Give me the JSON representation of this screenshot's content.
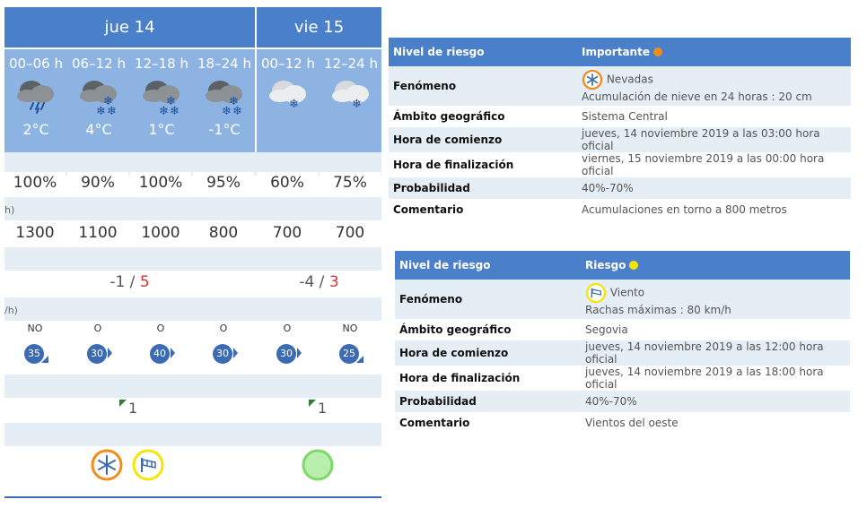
{
  "days": [
    {
      "label": "jue 14"
    },
    {
      "label": "vie 15"
    }
  ],
  "periods": [
    {
      "label": "00–06 h",
      "temp": "2°C",
      "icon": "cloud-rain-icon"
    },
    {
      "label": "06–12 h",
      "temp": "4°C",
      "icon": "cloud-snow-icon"
    },
    {
      "label": "12–18 h",
      "temp": "1°C",
      "icon": "cloud-snow-icon"
    },
    {
      "label": "18–24 h",
      "temp": "-1°C",
      "icon": "cloud-snow-icon"
    },
    {
      "label": "00–12 h",
      "temp": "",
      "icon": "cloud-snow-light-icon"
    },
    {
      "label": "12–24 h",
      "temp": "",
      "icon": "cloud-snow-light-icon"
    }
  ],
  "precip_prob_label": "",
  "precip_prob": [
    "100%",
    "90%",
    "100%",
    "95%",
    "60%",
    "75%"
  ],
  "snow_level_label": "h)",
  "snow_level": [
    "1300",
    "1100",
    "1000",
    "800",
    "700",
    "700"
  ],
  "temp_range": [
    {
      "min": "-1",
      "sep": " / ",
      "max": "5"
    },
    {
      "min": "-4",
      "sep": " / ",
      "max": "3"
    }
  ],
  "wind_label": "/h)",
  "wind": [
    {
      "dir": "NO",
      "speed": "35"
    },
    {
      "dir": "O",
      "speed": "30"
    },
    {
      "dir": "O",
      "speed": "40"
    },
    {
      "dir": "O",
      "speed": "30"
    },
    {
      "dir": "O",
      "speed": "30"
    },
    {
      "dir": "NO",
      "speed": "25"
    }
  ],
  "uv": [
    "1",
    "1"
  ],
  "warning_icons": {
    "snow": "snowflake-icon",
    "wind": "wind-icon",
    "none": "no-warning-icon"
  },
  "colors": {
    "header": "#4a7fc9",
    "period_bg": "#8db3e3",
    "band": "#e5eef5",
    "orange": "#f28c1a",
    "yellow": "#f5e50a",
    "green": "#7ed86a"
  },
  "alert1": {
    "rows": [
      {
        "k": "Nivel de riesgo",
        "v": "Importante"
      },
      {
        "k": "Fenómeno",
        "v": "Nevadas",
        "v2": "Acumulación de nieve en 24 horas : 20 cm"
      },
      {
        "k": "Ámbito geográfico",
        "v": "Sistema Central"
      },
      {
        "k": "Hora de comienzo",
        "v": "jueves, 14 noviembre 2019 a las 03:00 hora oficial"
      },
      {
        "k": "Hora de finalización",
        "v": "viernes, 15 noviembre 2019 a las 00:00 hora oficial"
      },
      {
        "k": "Probabilidad",
        "v": "40%-70%"
      },
      {
        "k": "Comentario",
        "v": "Acumulaciones en torno a 800 metros"
      }
    ]
  },
  "alert2": {
    "rows": [
      {
        "k": "Nivel de riesgo",
        "v": "Riesgo"
      },
      {
        "k": "Fenómeno",
        "v": "Viento",
        "v2": "Rachas máximas : 80 km/h"
      },
      {
        "k": "Ámbito geográfico",
        "v": "Segovia"
      },
      {
        "k": "Hora de comienzo",
        "v": "jueves, 14 noviembre 2019 a las 12:00 hora oficial"
      },
      {
        "k": "Hora de finalización",
        "v": "jueves, 14 noviembre 2019 a las 18:00 hora oficial"
      },
      {
        "k": "Probabilidad",
        "v": "40%-70%"
      },
      {
        "k": "Comentario",
        "v": "Vientos del oeste"
      }
    ]
  }
}
